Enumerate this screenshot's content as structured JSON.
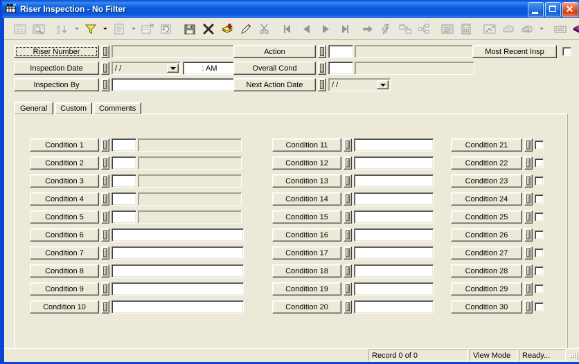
{
  "window": {
    "title": "Riser Inspection - No Filter",
    "title_icon": "form-grid-icon",
    "minimize_label": "Minimize",
    "maximize_label": "Maximize",
    "close_label": "Close",
    "accent_titlebar": "#0b55dc",
    "face_color": "#ece9d8"
  },
  "toolbar": {
    "items": [
      {
        "name": "table-view-button",
        "icon": "table-grid-icon",
        "enabled": false
      },
      {
        "name": "query-design-button",
        "icon": "query-design-icon",
        "enabled": false
      },
      {
        "name": "sort-button",
        "icon": "sort-az-icon",
        "enabled": false,
        "dropdown": true
      },
      {
        "name": "filter-button",
        "icon": "filter-funnel-icon",
        "enabled": true,
        "dropdown": true
      },
      {
        "name": "report-button",
        "icon": "report-page-icon",
        "enabled": false,
        "dropdown": true
      },
      {
        "name": "properties-button",
        "icon": "properties-icon",
        "enabled": false
      },
      {
        "name": "refresh-button",
        "icon": "refresh-window-icon",
        "enabled": false
      },
      {
        "name": "save-record-button",
        "icon": "floppy-save-icon",
        "enabled": true
      },
      {
        "name": "delete-record-button",
        "icon": "delete-x-icon",
        "enabled": true
      },
      {
        "name": "add-record-button",
        "icon": "add-stack-icon",
        "enabled": true
      },
      {
        "name": "edit-record-button",
        "icon": "pencil-edit-icon",
        "enabled": true
      },
      {
        "name": "cut-button",
        "icon": "scissors-cut-icon",
        "enabled": false
      },
      {
        "name": "first-record-button",
        "icon": "nav-first-icon",
        "enabled": false
      },
      {
        "name": "previous-record-button",
        "icon": "nav-previous-icon",
        "enabled": false
      },
      {
        "name": "next-record-button",
        "icon": "nav-next-icon",
        "enabled": false
      },
      {
        "name": "last-record-button",
        "icon": "nav-last-icon",
        "enabled": false
      },
      {
        "name": "goto-record-button",
        "icon": "arrow-right-icon",
        "enabled": false
      },
      {
        "name": "quick-action-button",
        "icon": "lightning-icon",
        "enabled": false
      },
      {
        "name": "relationships-button",
        "icon": "relationships-icon",
        "enabled": false
      },
      {
        "name": "hierarchy-button",
        "icon": "hierarchy-icon",
        "enabled": false
      },
      {
        "name": "list-view-button",
        "icon": "list-lines-icon",
        "enabled": false
      },
      {
        "name": "calculator-button",
        "icon": "calculator-icon",
        "enabled": false
      },
      {
        "name": "chart-button",
        "icon": "scatter-chart-icon",
        "enabled": false
      },
      {
        "name": "note-button",
        "icon": "note-cloud-icon",
        "enabled": false
      },
      {
        "name": "help-search-button",
        "icon": "search-cloud-icon",
        "enabled": false,
        "dropdown": true
      },
      {
        "name": "keyboard-button",
        "icon": "keyboard-icon",
        "enabled": false
      },
      {
        "name": "library-button",
        "icon": "book-stack-icon",
        "enabled": true,
        "dropdown": true
      },
      {
        "name": "export-button",
        "icon": "export-flag-icon",
        "enabled": true
      }
    ]
  },
  "header": {
    "left_fields": [
      {
        "label": "Riser Number",
        "name": "riser-number",
        "value": "",
        "focused": true,
        "kind": "readonly"
      },
      {
        "label": "Inspection Date",
        "name": "inspection-date",
        "value": "",
        "kind": "date-time",
        "date_value": "  /  /",
        "time_value": ":  AM"
      },
      {
        "label": "Inspection By",
        "name": "inspection-by",
        "value": "",
        "kind": "text"
      }
    ],
    "mid_fields": [
      {
        "label": "Action",
        "name": "action",
        "code": "",
        "desc": "",
        "kind": "code-desc"
      },
      {
        "label": "Overall Cond",
        "name": "overall-cond",
        "code": "",
        "desc": "",
        "kind": "code-desc"
      },
      {
        "label": "Next Action Date",
        "name": "next-action-date",
        "date_value": "  /  /",
        "kind": "date"
      }
    ],
    "most_recent_label": "Most Recent Insp",
    "most_recent_checked": false
  },
  "tabs": [
    {
      "label": "General",
      "name": "tab-general",
      "active": true
    },
    {
      "label": "Custom",
      "name": "tab-custom",
      "active": false
    },
    {
      "label": "Comments",
      "name": "tab-comments",
      "active": false
    }
  ],
  "conditions": {
    "col1": [
      {
        "label": "Condition 1",
        "kind": "code-desc",
        "code": "",
        "desc": ""
      },
      {
        "label": "Condition 2",
        "kind": "code-desc",
        "code": "",
        "desc": ""
      },
      {
        "label": "Condition 3",
        "kind": "code-desc",
        "code": "",
        "desc": ""
      },
      {
        "label": "Condition 4",
        "kind": "code-desc",
        "code": "",
        "desc": ""
      },
      {
        "label": "Condition 5",
        "kind": "code-desc",
        "code": "",
        "desc": ""
      },
      {
        "label": "Condition 6",
        "kind": "text",
        "value": ""
      },
      {
        "label": "Condition 7",
        "kind": "text",
        "value": ""
      },
      {
        "label": "Condition 8",
        "kind": "text",
        "value": ""
      },
      {
        "label": "Condition 9",
        "kind": "text",
        "value": ""
      },
      {
        "label": "Condition 10",
        "kind": "text",
        "value": ""
      }
    ],
    "col2": [
      {
        "label": "Condition 11",
        "kind": "text",
        "value": ""
      },
      {
        "label": "Condition 12",
        "kind": "text",
        "value": ""
      },
      {
        "label": "Condition 13",
        "kind": "text",
        "value": ""
      },
      {
        "label": "Condition 14",
        "kind": "text",
        "value": ""
      },
      {
        "label": "Condition 15",
        "kind": "text",
        "value": ""
      },
      {
        "label": "Condition 16",
        "kind": "text",
        "value": ""
      },
      {
        "label": "Condition 17",
        "kind": "text",
        "value": ""
      },
      {
        "label": "Condition 18",
        "kind": "text",
        "value": ""
      },
      {
        "label": "Condition 19",
        "kind": "text",
        "value": ""
      },
      {
        "label": "Condition 20",
        "kind": "text",
        "value": ""
      }
    ],
    "col3": [
      {
        "label": "Condition 21",
        "kind": "checkbox",
        "checked": false
      },
      {
        "label": "Condition 22",
        "kind": "checkbox",
        "checked": false
      },
      {
        "label": "Condition 23",
        "kind": "checkbox",
        "checked": false
      },
      {
        "label": "Condition 24",
        "kind": "checkbox",
        "checked": false
      },
      {
        "label": "Condition 25",
        "kind": "checkbox",
        "checked": false
      },
      {
        "label": "Condition 26",
        "kind": "checkbox",
        "checked": false
      },
      {
        "label": "Condition 27",
        "kind": "checkbox",
        "checked": false
      },
      {
        "label": "Condition 28",
        "kind": "checkbox",
        "checked": false
      },
      {
        "label": "Condition 29",
        "kind": "checkbox",
        "checked": false
      },
      {
        "label": "Condition 30",
        "kind": "checkbox",
        "checked": false
      }
    ]
  },
  "statusbar": {
    "record": "Record 0 of 0",
    "mode": "View Mode",
    "state": "Ready..."
  }
}
